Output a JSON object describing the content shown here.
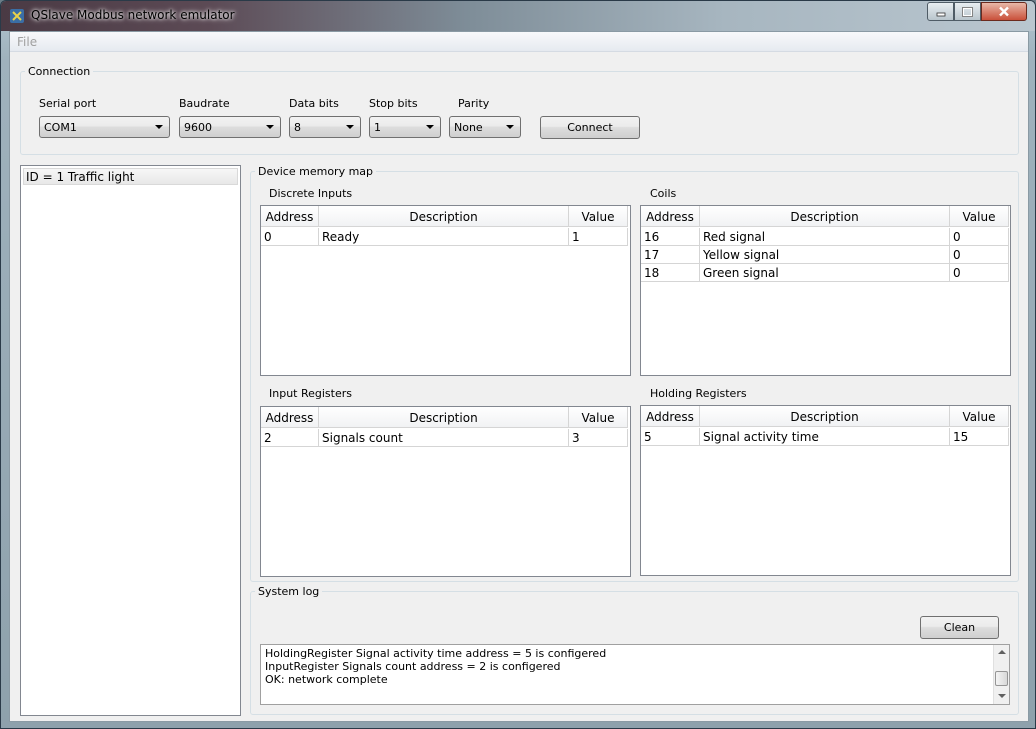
{
  "window": {
    "title": "QSlave Modbus network emulator"
  },
  "menu": {
    "file": "File"
  },
  "connection": {
    "title": "Connection",
    "serial_port": {
      "label": "Serial port",
      "value": "COM1"
    },
    "baudrate": {
      "label": "Baudrate",
      "value": "9600"
    },
    "data_bits": {
      "label": "Data bits",
      "value": "8"
    },
    "stop_bits": {
      "label": "Stop bits",
      "value": "1"
    },
    "parity": {
      "label": "Parity",
      "value": "None"
    },
    "connect_label": "Connect"
  },
  "devices": [
    {
      "label": "ID = 1 Traffic light"
    }
  ],
  "memory_map": {
    "title": "Device memory map",
    "columns": {
      "address": "Address",
      "description": "Description",
      "value": "Value"
    },
    "discrete_inputs": {
      "title": "Discrete Inputs",
      "rows": [
        {
          "address": "0",
          "description": "Ready",
          "value": "1"
        }
      ]
    },
    "coils": {
      "title": "Coils",
      "rows": [
        {
          "address": "16",
          "description": "Red signal",
          "value": "0"
        },
        {
          "address": "17",
          "description": "Yellow signal",
          "value": "0"
        },
        {
          "address": "18",
          "description": "Green signal",
          "value": "0"
        }
      ]
    },
    "input_registers": {
      "title": "Input Registers",
      "rows": [
        {
          "address": "2",
          "description": "Signals count",
          "value": "3"
        }
      ]
    },
    "holding_registers": {
      "title": "Holding Registers",
      "rows": [
        {
          "address": "5",
          "description": "Signal activity time",
          "value": "15"
        }
      ]
    }
  },
  "system_log": {
    "title": "System log",
    "clean_label": "Clean",
    "lines": [
      "HoldingRegister Signal activity time address = 5 is configered",
      "InputRegister Signals count address = 2 is configered",
      "OK: network complete"
    ]
  }
}
